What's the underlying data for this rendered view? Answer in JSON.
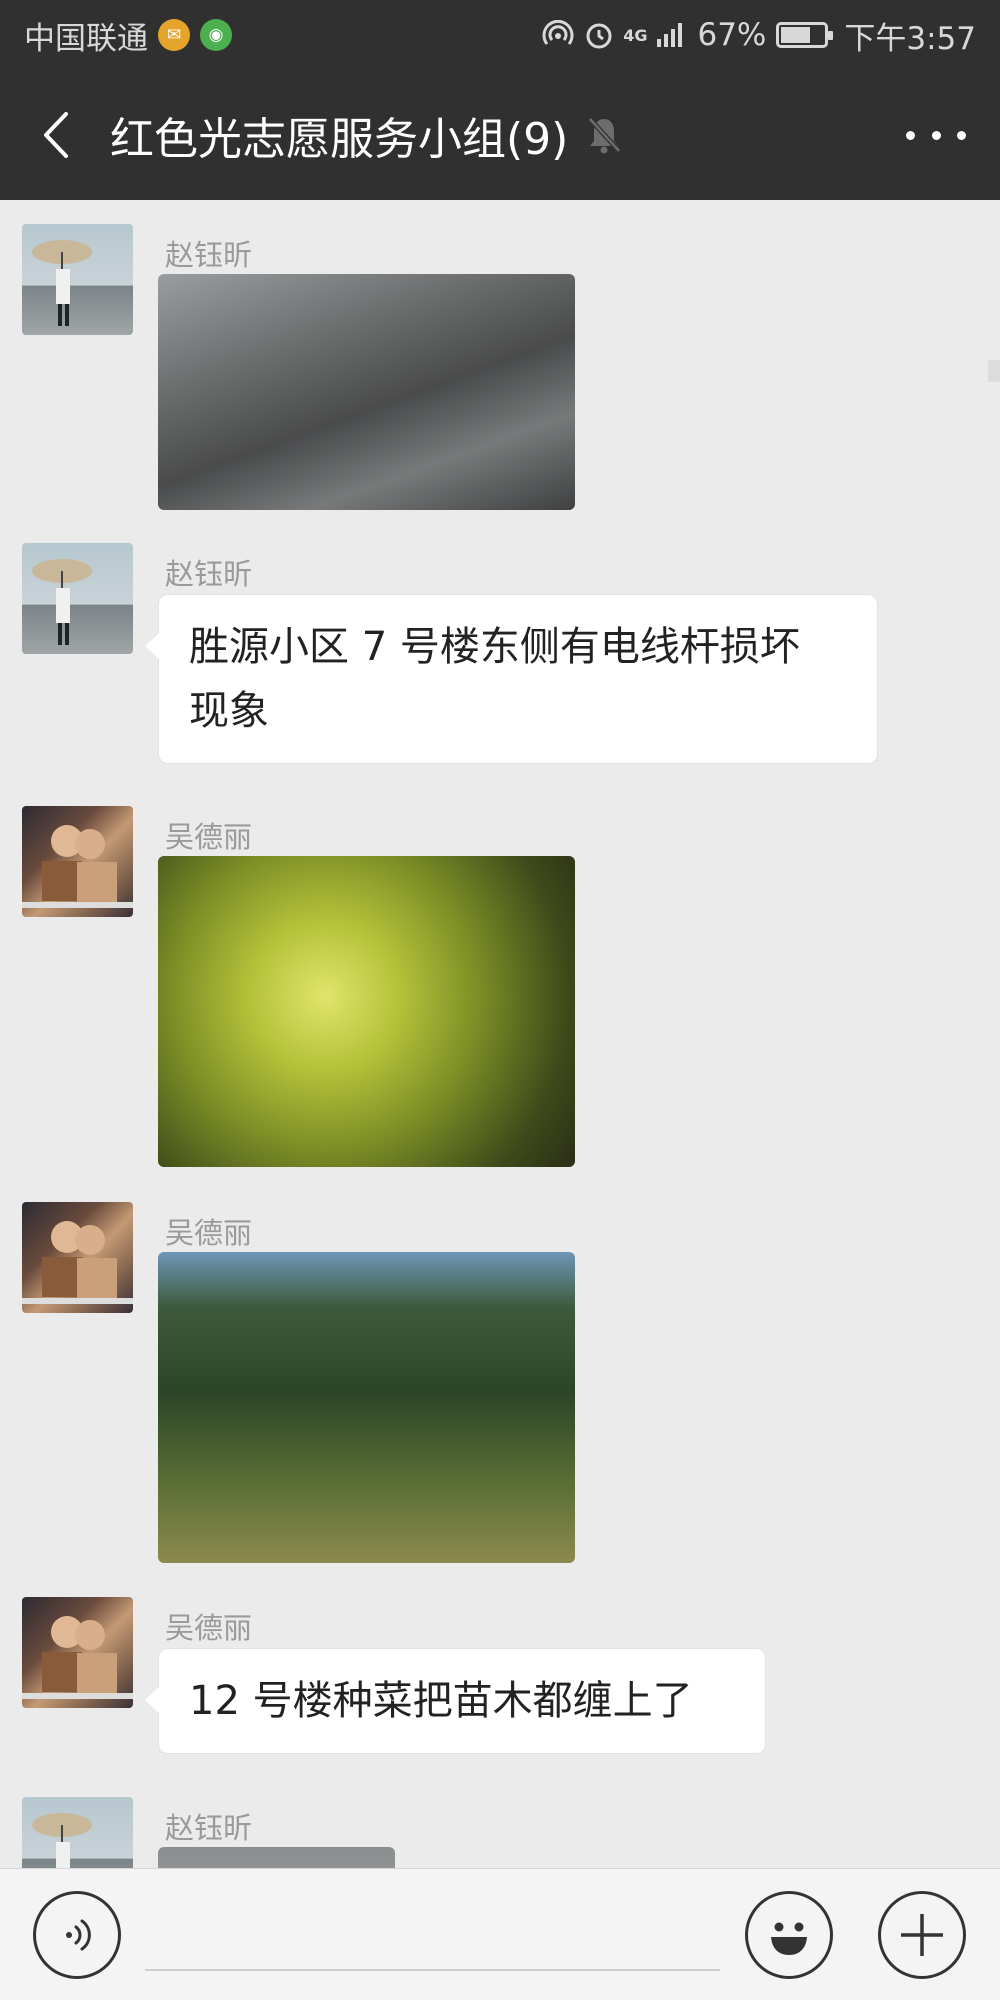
{
  "status_bar": {
    "carrier": "中国联通",
    "network": "4G",
    "battery": "67%",
    "time": "下午3:57",
    "icons": [
      "mail-notification-icon",
      "app-notification-icon",
      "hotspot-icon",
      "alarm-icon",
      "signal-icon",
      "battery-icon"
    ]
  },
  "header": {
    "title": "红色光志愿服务小组(9)",
    "back_icon": "back-arrow-icon",
    "mute_icon": "muted-bell-icon",
    "more_icon": "more-dots-icon"
  },
  "messages": [
    {
      "sender": "赵钰昕",
      "type": "image",
      "image_desc": "shadow-on-pavement"
    },
    {
      "sender": "赵钰昕",
      "type": "text",
      "lines": [
        "胜源小区 7 号楼东侧有电线杆损坏",
        "现象"
      ]
    },
    {
      "sender": "吴德丽",
      "type": "image",
      "image_desc": "yellow-shrub"
    },
    {
      "sender": "吴德丽",
      "type": "image",
      "image_desc": "overgrown-garden"
    },
    {
      "sender": "吴德丽",
      "type": "text",
      "lines": [
        "12 号楼种菜把苗木都缠上了"
      ]
    },
    {
      "sender": "赵钰昕",
      "type": "image",
      "image_desc": "partial-image"
    }
  ],
  "input_bar": {
    "voice_icon": "voice-icon",
    "emoji_icon": "emoji-icon",
    "plus_icon": "plus-icon",
    "placeholder": ""
  },
  "colors": {
    "header_bg": "#303030",
    "chat_bg": "#ebebeb",
    "bubble_bg": "#ffffff",
    "sender_name": "#9a9a9a"
  }
}
